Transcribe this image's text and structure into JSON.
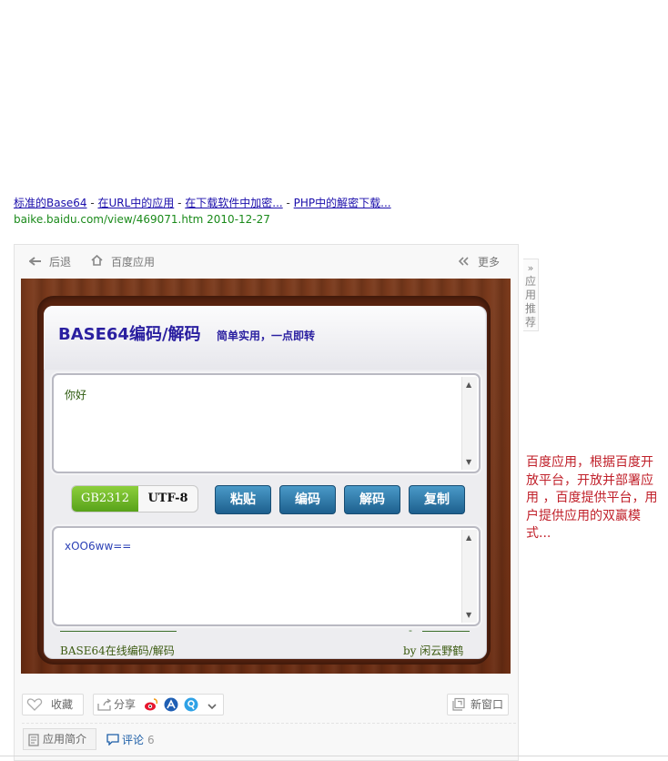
{
  "result": {
    "links": [
      "标准的Base64",
      "在URL中的应用",
      "在下载软件中加密...",
      "PHP中的解密下载..."
    ],
    "url": "baike.baidu.com/view/469071.htm 2010-12-27"
  },
  "toolbar": {
    "back": "后退",
    "home": "百度应用",
    "more": "更多"
  },
  "side_tab": {
    "label": "应用推荐"
  },
  "app": {
    "title": "BASE64编码/解码",
    "subtitle": "简单实用，一点即转",
    "input_text": "你好",
    "output_text": "xOO6ww==",
    "encodings": {
      "selected": "GB2312",
      "other": "UTF-8"
    },
    "buttons": {
      "paste": "粘贴",
      "encode": "编码",
      "decode": "解码",
      "copy": "复制"
    },
    "footer_left": "BASE64在线编码/解码",
    "footer_right": "by 闲云野鹤"
  },
  "note": "百度应用，根据百度开放平台，开放并部署应用 ，百度提供平台，用户提供应用的双赢模式...",
  "bottom": {
    "favorite": "收藏",
    "share": "分享",
    "new_window": "新窗口",
    "intro_tab": "应用简介",
    "comment_tab": "评论",
    "comment_count": "6"
  },
  "colors": {
    "title_blue": "#2a1fa0",
    "note_red": "#c0202a",
    "button_blue": "#1d5f8e",
    "encoding_green": "#58a21a"
  }
}
